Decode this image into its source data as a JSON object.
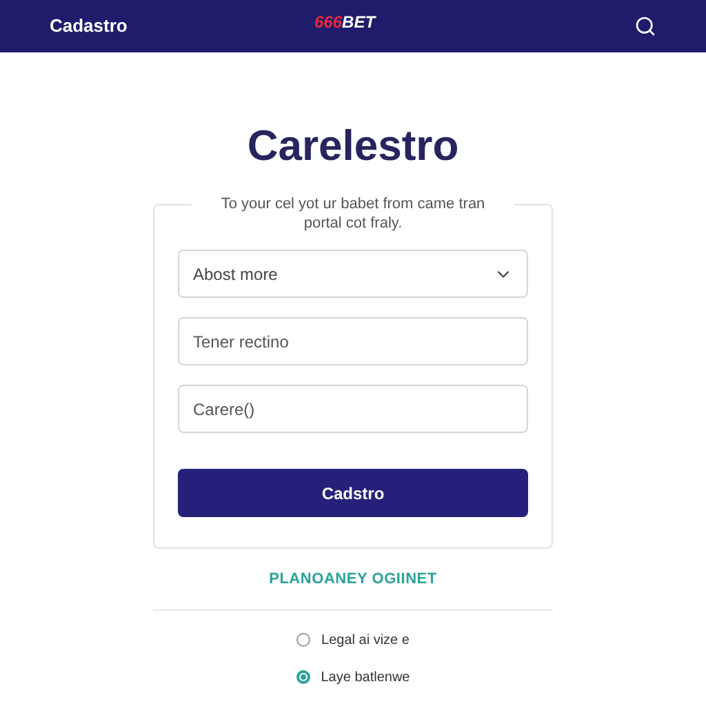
{
  "header": {
    "title": "Cadastro",
    "logo": {
      "accent": "666",
      "rest": "BET"
    }
  },
  "heading": "Carelestro",
  "form": {
    "legend": "To your cel yot ur babet from came tran portal cot fraly.",
    "fields": [
      {
        "kind": "select",
        "value": "Abost more"
      },
      {
        "kind": "input",
        "placeholder": "Tener rectino"
      },
      {
        "kind": "input",
        "placeholder": "Carere()"
      }
    ],
    "submit": "Cadstro"
  },
  "link": "PLANOANEY OGIINET",
  "options": [
    {
      "label": "Legal ai vize e",
      "selected": false
    },
    {
      "label": "Laye batlenwe",
      "selected": true
    }
  ]
}
